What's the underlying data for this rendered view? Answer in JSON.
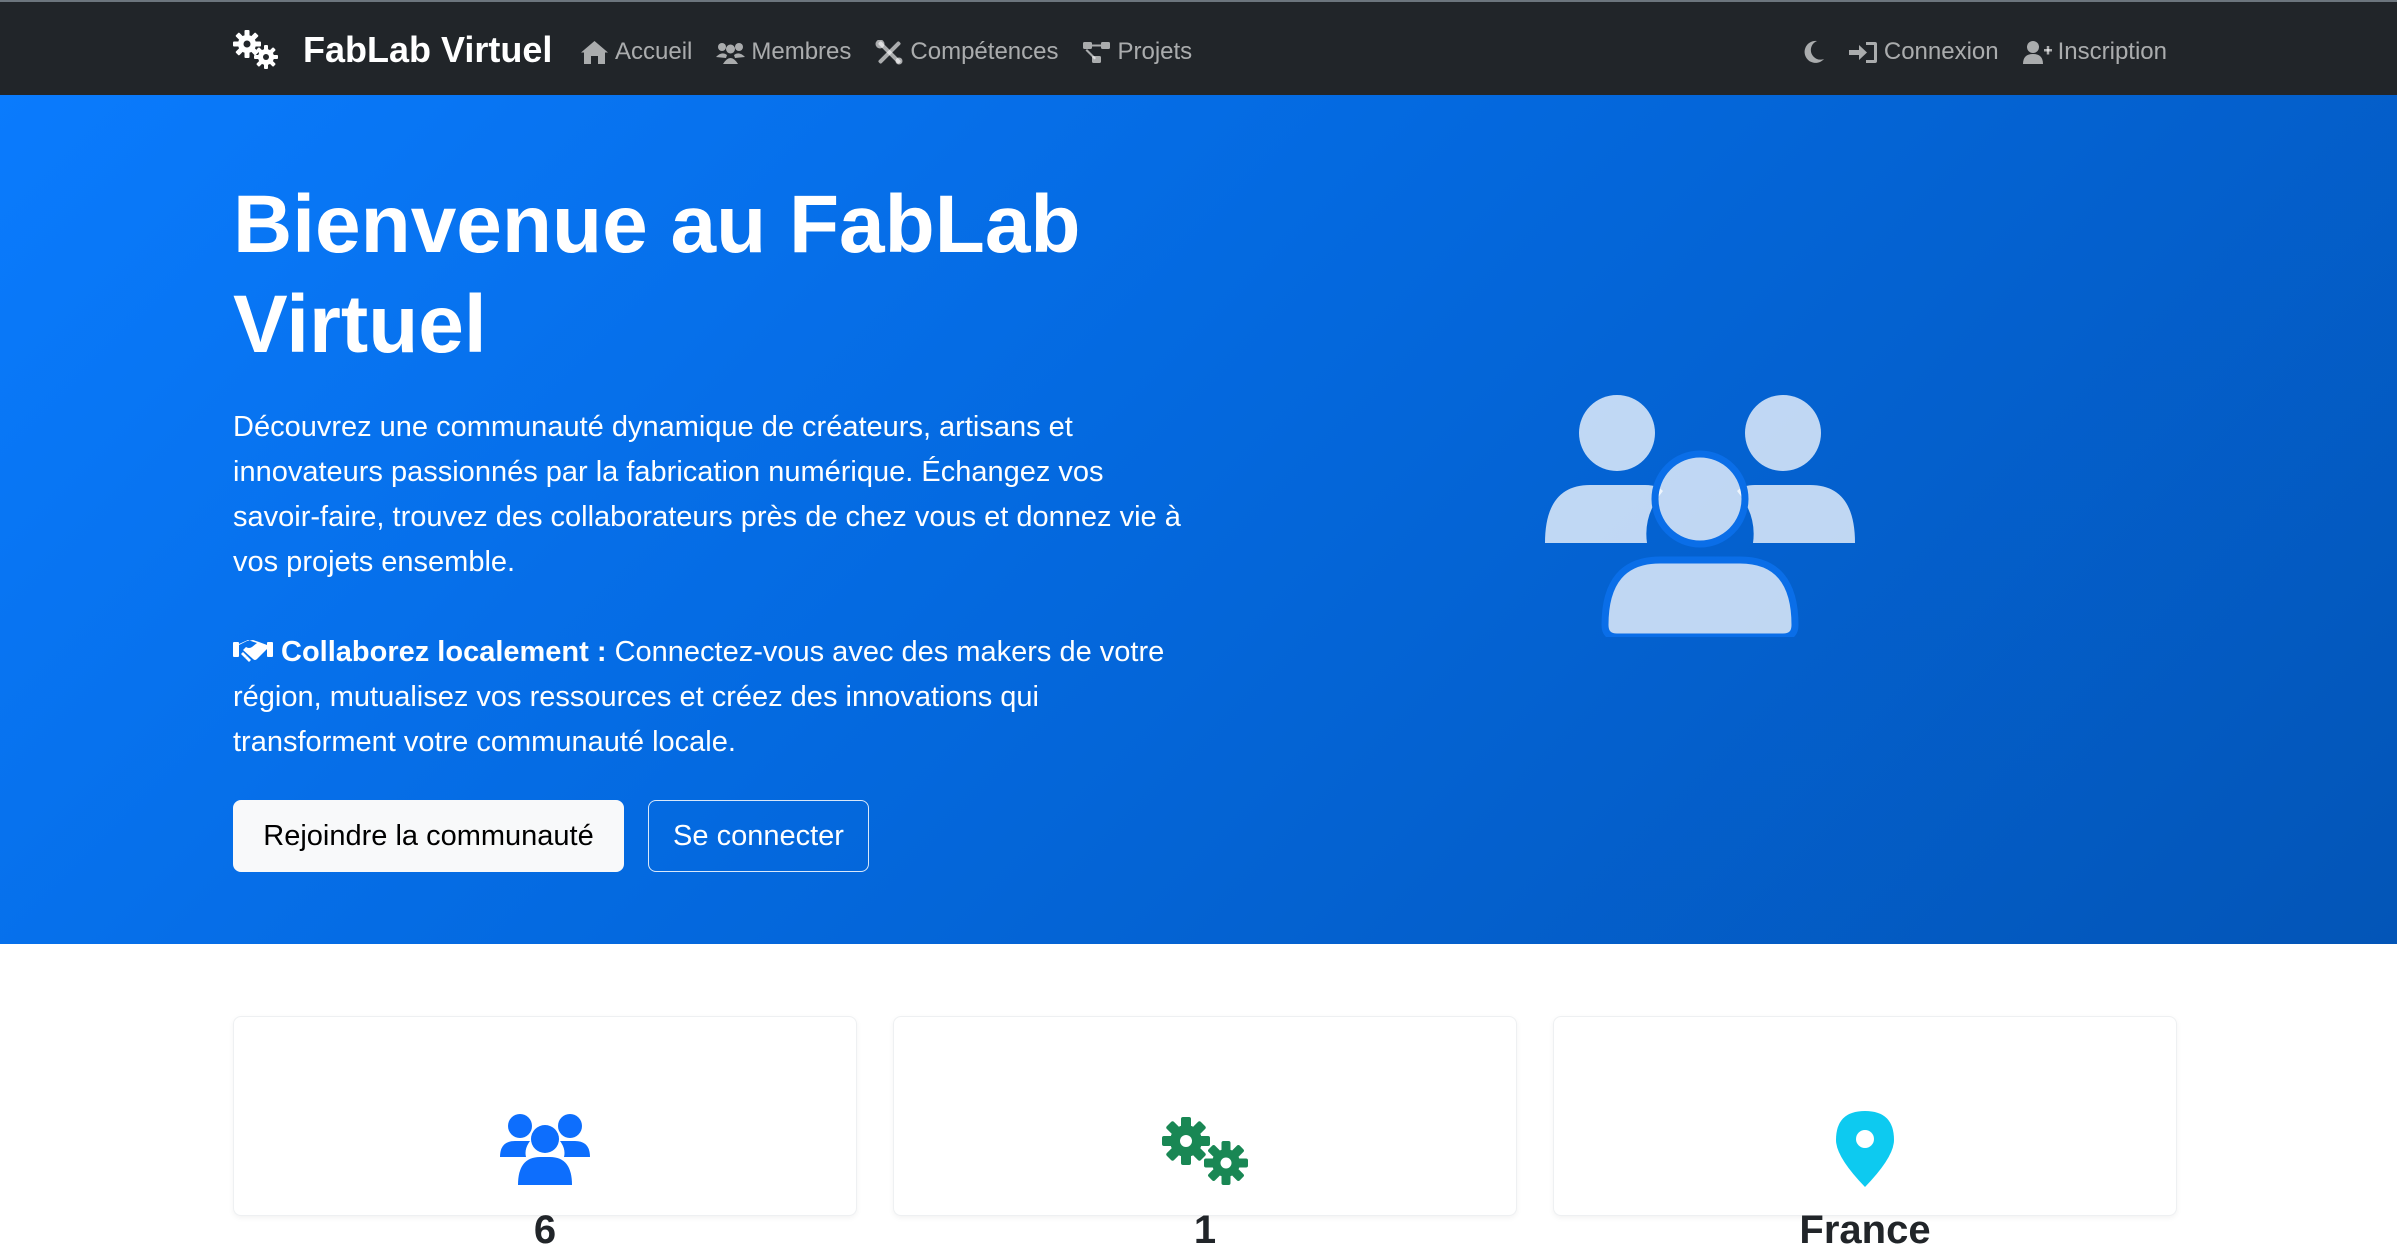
{
  "navbar": {
    "brand": "FabLab Virtuel",
    "brand_icon": "gears-icon",
    "links": [
      {
        "label": "Accueil",
        "icon": "home-icon"
      },
      {
        "label": "Membres",
        "icon": "users-icon"
      },
      {
        "label": "Compétences",
        "icon": "tools-icon"
      },
      {
        "label": "Projets",
        "icon": "project-diagram-icon"
      }
    ],
    "theme_toggle_icon": "moon-icon",
    "right_links": [
      {
        "label": "Connexion",
        "icon": "sign-in-icon"
      },
      {
        "label": "Inscription",
        "icon": "user-plus-icon"
      }
    ]
  },
  "hero": {
    "title": "Bienvenue au FabLab Virtuel",
    "lead": "Découvrez une communauté dynamique de créateurs, artisans et innovateurs passionnés par la fabrication numérique. Échangez vos savoir-faire, trouvez des collaborateurs près de chez vous et donnez vie à vos projets ensemble.",
    "collab_icon": "handshake-icon",
    "collab_label": "Collaborez localement :",
    "collab_text": " Connectez-vous avec des makers de votre région, mutualisez vos ressources et créez des innovations qui transforment votre communauté locale.",
    "btn_join": "Rejoindre la communauté",
    "btn_login": "Se connecter",
    "illustration_icon": "users-icon"
  },
  "stats": [
    {
      "value": "6",
      "icon": "users-icon",
      "color": "#0d6efd"
    },
    {
      "value": "1",
      "icon": "gears-icon",
      "color": "#198754"
    },
    {
      "value": "France",
      "icon": "map-marker-icon",
      "color": "#0dcaf0"
    }
  ],
  "colors": {
    "navbar_bg": "#212529",
    "hero_gradient_start": "#0a7bfd",
    "hero_gradient_end": "#0355b7",
    "primary": "#0d6efd",
    "success": "#198754",
    "info": "#0dcaf0"
  }
}
